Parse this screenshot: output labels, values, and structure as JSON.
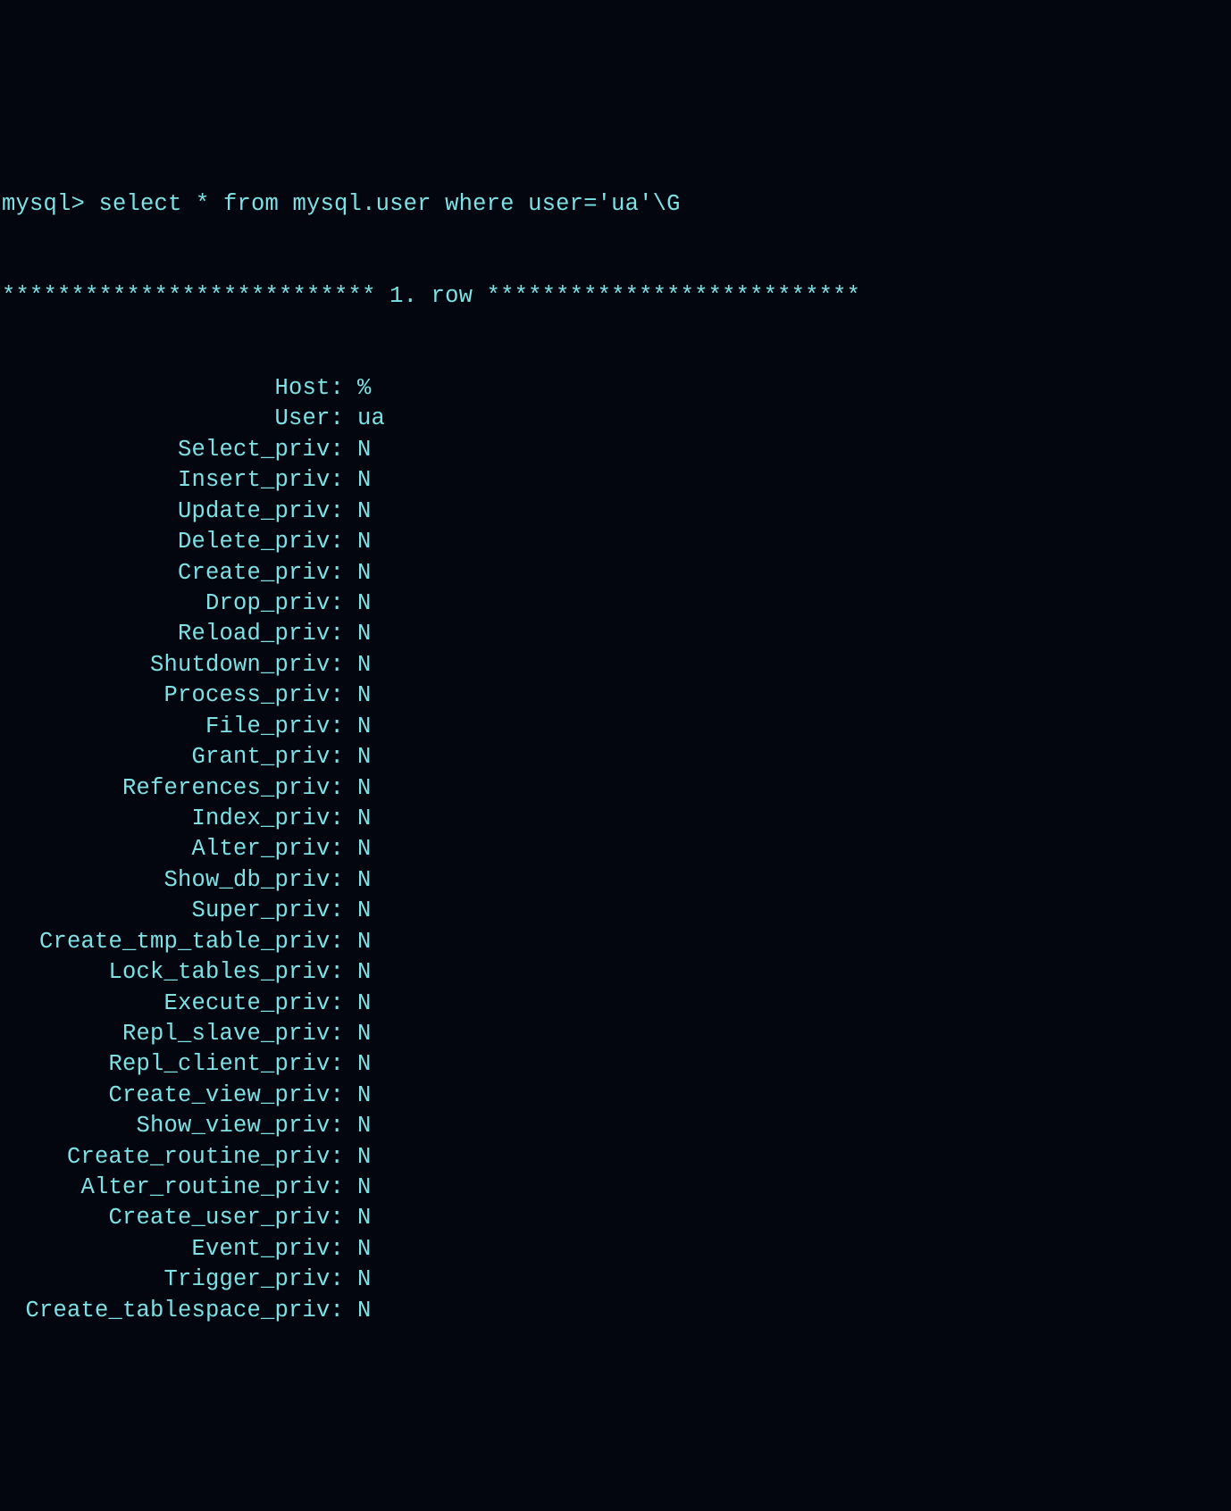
{
  "prompt": "mysql> select * from mysql.user where user='ua'\\G",
  "separator": "*************************** 1. row ***************************",
  "rows": [
    {
      "key": "Host:",
      "value": "%"
    },
    {
      "key": "User:",
      "value": "ua"
    },
    {
      "key": "Select_priv:",
      "value": "N"
    },
    {
      "key": "Insert_priv:",
      "value": "N"
    },
    {
      "key": "Update_priv:",
      "value": "N"
    },
    {
      "key": "Delete_priv:",
      "value": "N"
    },
    {
      "key": "Create_priv:",
      "value": "N"
    },
    {
      "key": "Drop_priv:",
      "value": "N"
    },
    {
      "key": "Reload_priv:",
      "value": "N"
    },
    {
      "key": "Shutdown_priv:",
      "value": "N"
    },
    {
      "key": "Process_priv:",
      "value": "N"
    },
    {
      "key": "File_priv:",
      "value": "N"
    },
    {
      "key": "Grant_priv:",
      "value": "N"
    },
    {
      "key": "References_priv:",
      "value": "N"
    },
    {
      "key": "Index_priv:",
      "value": "N"
    },
    {
      "key": "Alter_priv:",
      "value": "N"
    },
    {
      "key": "Show_db_priv:",
      "value": "N"
    },
    {
      "key": "Super_priv:",
      "value": "N"
    },
    {
      "key": "Create_tmp_table_priv:",
      "value": "N"
    },
    {
      "key": "Lock_tables_priv:",
      "value": "N"
    },
    {
      "key": "Execute_priv:",
      "value": "N"
    },
    {
      "key": "Repl_slave_priv:",
      "value": "N"
    },
    {
      "key": "Repl_client_priv:",
      "value": "N"
    },
    {
      "key": "Create_view_priv:",
      "value": "N"
    },
    {
      "key": "Show_view_priv:",
      "value": "N"
    },
    {
      "key": "Create_routine_priv:",
      "value": "N"
    },
    {
      "key": "Alter_routine_priv:",
      "value": "N"
    },
    {
      "key": "Create_user_priv:",
      "value": "N"
    },
    {
      "key": "Event_priv:",
      "value": "N"
    },
    {
      "key": "Trigger_priv:",
      "value": "N"
    },
    {
      "key": "Create_tablespace_priv:",
      "value": "N"
    }
  ]
}
